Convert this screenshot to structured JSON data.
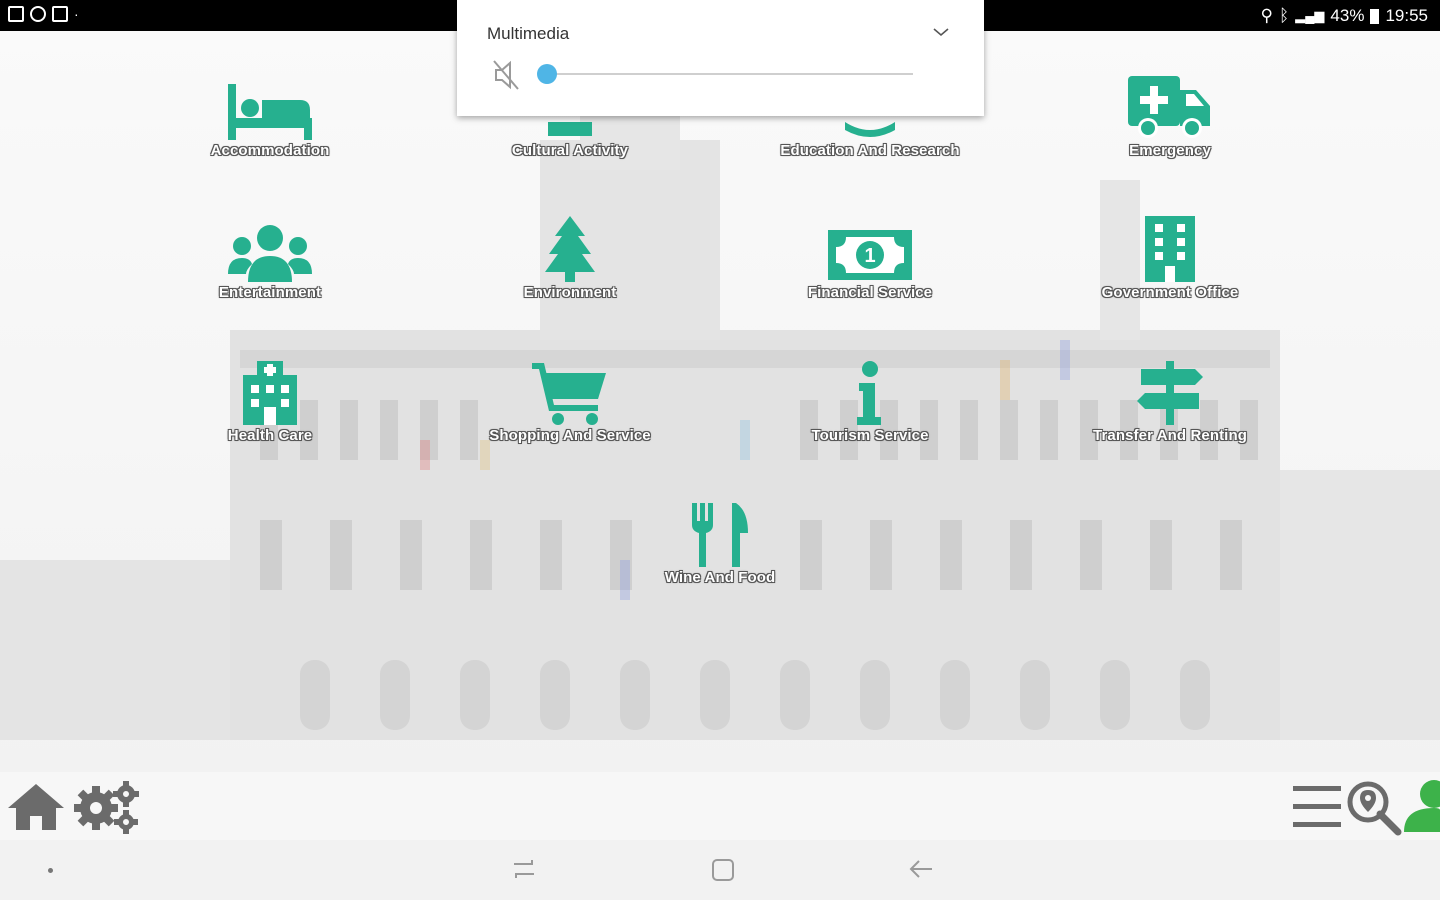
{
  "status_bar": {
    "battery": "43%",
    "time": "19:55"
  },
  "volume_popup": {
    "title": "Multimedia",
    "level": 0
  },
  "categories": [
    {
      "label": "Accommodation",
      "icon": "bed-icon"
    },
    {
      "label": "Cultural Activity",
      "icon": "cultural-activity-icon"
    },
    {
      "label": "Education And Research",
      "icon": "education-icon"
    },
    {
      "label": "Emergency",
      "icon": "ambulance-icon"
    },
    {
      "label": "Entertainment",
      "icon": "group-icon"
    },
    {
      "label": "Environment",
      "icon": "tree-icon"
    },
    {
      "label": "Financial Service",
      "icon": "money-icon"
    },
    {
      "label": "Government Office",
      "icon": "building-icon"
    },
    {
      "label": "Health Care",
      "icon": "hospital-icon"
    },
    {
      "label": "Shopping And Service",
      "icon": "cart-icon"
    },
    {
      "label": "Tourism Service",
      "icon": "info-icon"
    },
    {
      "label": "Transfer And Renting",
      "icon": "signpost-icon"
    },
    {
      "label": "Wine And Food",
      "icon": "fork-knife-icon"
    }
  ],
  "toolbar": {
    "left": [
      "home-icon",
      "settings-gears-icon"
    ],
    "right": [
      "menu-icon",
      "map-search-icon",
      "user-icon"
    ]
  },
  "colors": {
    "accent": "#26b08f",
    "volume_thumb": "#4fb5e6",
    "toolbar_icon": "#6b6b6b",
    "user_icon": "#3db24a"
  }
}
